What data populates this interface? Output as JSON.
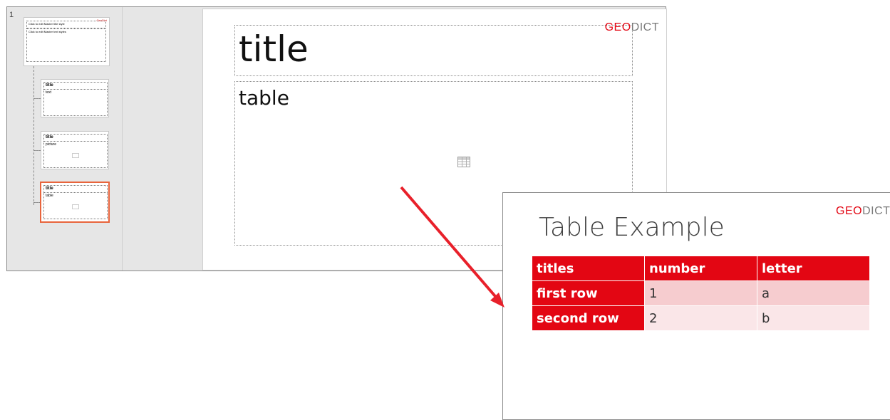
{
  "thumbnails": {
    "slide_number": "1",
    "master": {
      "title": "Click to edit Master title style",
      "text": "Click to edit Master text styles",
      "logo": "GeoDict"
    },
    "layouts": [
      {
        "title": "title",
        "body": "text"
      },
      {
        "title": "title",
        "body": "picture"
      },
      {
        "title": "title",
        "body": "table"
      }
    ]
  },
  "slide": {
    "title_placeholder": "title",
    "body_placeholder": "table",
    "logo_geo": "GEO",
    "logo_dict": "DICT"
  },
  "callout": {
    "title": "Table Example",
    "logo_geo": "GEO",
    "logo_dict": "DICT",
    "table": {
      "headers": [
        "titles",
        "number",
        "letter"
      ],
      "rows": [
        [
          "first row",
          "1",
          "a"
        ],
        [
          "second row",
          "2",
          "b"
        ]
      ]
    }
  },
  "colors": {
    "accent": "#e30613",
    "selection": "#e8643c",
    "arrow": "#e8202a"
  }
}
